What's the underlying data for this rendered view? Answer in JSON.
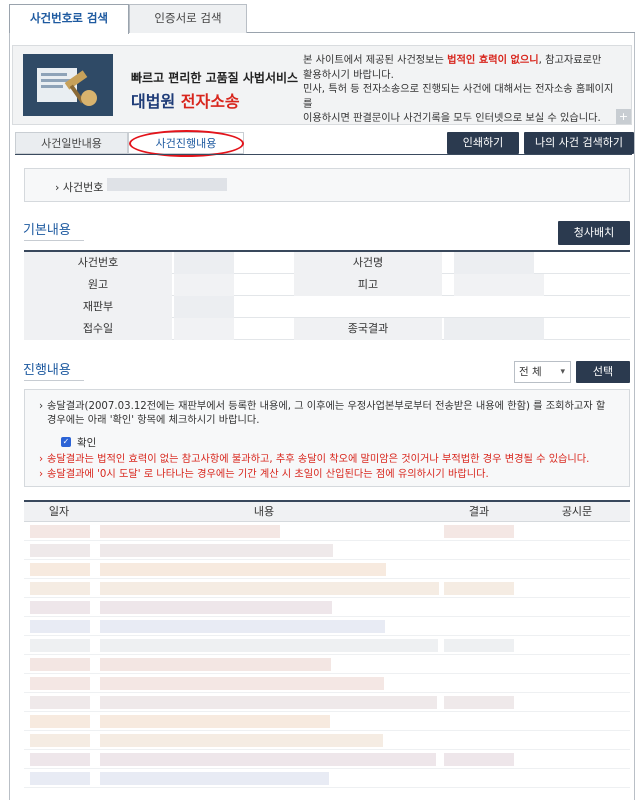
{
  "search_tabs": {
    "by_case_number": "사건번호로 검색",
    "by_document": "인증서로 검색"
  },
  "banner": {
    "tagline": "빠르고 편리한 고품질 사법서비스",
    "brand_main": "대법원",
    "brand_accent": "전자소송",
    "note_line1_a": "본 사이트에서 제공된 사건정보는 ",
    "note_line1_hl": "법적인 효력이 없으니",
    "note_line1_b": ", 참고자료로만",
    "note_line2": "활용하시기 바랍니다.",
    "note_line3": "민사, 특허 등 전자소송으로 진행되는 사건에 대해서는 전자소송 홈페이지를",
    "note_line4": "이용하시면 판결문이나 사건기록을 모두 인터넷으로 보실 수 있습니다.",
    "corner": "+"
  },
  "detail_tabs": {
    "general": "사건일반내용",
    "progress": "사건진행내용"
  },
  "buttons": {
    "print": "인쇄하기",
    "my_case_search": "나의 사건 검색하기",
    "print_small": "청사배치",
    "select": "선택"
  },
  "case_number_label": "사건번호 :",
  "basic": {
    "title": "기본내용",
    "labels": {
      "case_no": "사건번호",
      "case_name": "사건명",
      "plaintiff": "원고",
      "defendant": "피고",
      "court": "재판부",
      "filed": "접수일",
      "result": "종국결과"
    }
  },
  "progress": {
    "title": "진행내용",
    "filter_value": "전 체",
    "notice1_line1": "송달결과(2007.03.12전에는 재판부에서 등록한 내용에, 그 이후에는 우정사업본부로부터 전송받은 내용에 한함) 를 조회하고자 할",
    "notice1_line2": "경우에는 아래 '확인' 항목에 체크하시기 바랍니다.",
    "checkbox_label": "확인",
    "notice2": "송달결과는 법적인 효력이 없는 참고사항에 불과하고, 추후 송달이 착오에 말미암은 것이거나 부적법한 경우 변경될 수 있습니다.",
    "notice3": "송달결과에 '0시 도달' 로 나타나는 경우에는 기간 계산 시 초일이 산입된다는 점에 유의하시기 바랍니다.",
    "columns": {
      "date": "일자",
      "content": "내용",
      "result": "결과",
      "notice": "공시문"
    }
  },
  "colors": {
    "accent_blue": "#1e5aa0",
    "dark_button": "#2b3a4f",
    "alert_red": "#d8261d"
  }
}
